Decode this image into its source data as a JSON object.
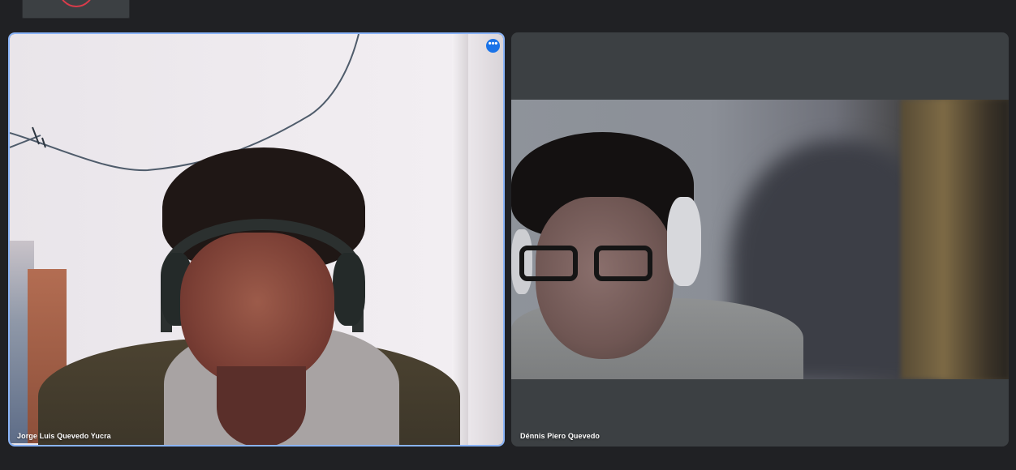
{
  "participants": [
    {
      "name": "Jorge Luis Quevedo Yucra",
      "active_speaker": true,
      "more_options_glyph": "•••"
    },
    {
      "name": "Dénnis Piero Quevedo",
      "active_speaker": false
    }
  ],
  "colors": {
    "background": "#202124",
    "tile": "#3c4043",
    "active_outline": "#8ab4f8",
    "more_button": "#1a73e8"
  },
  "icons": {
    "more_options": "more-horizontal-icon"
  }
}
